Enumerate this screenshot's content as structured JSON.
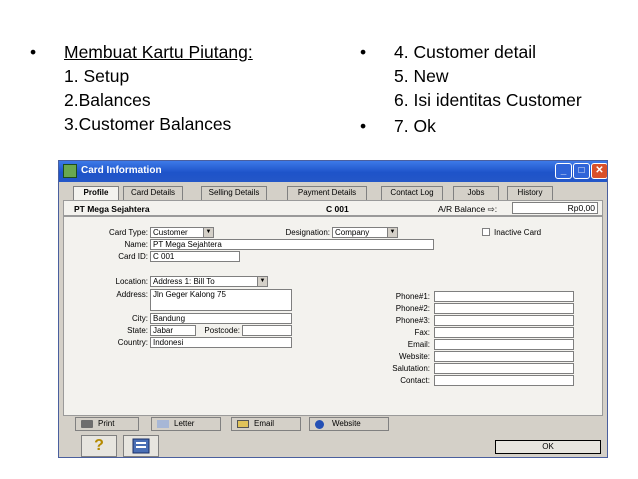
{
  "slide": {
    "left_bullets": [
      "Membuat Kartu Piutang:"
    ],
    "left_sub_lines": [
      "1. Setup",
      "2.Balances",
      "3.Customer Balances"
    ],
    "right_bullets": [
      {
        "lines": [
          "4. Customer detail",
          "5. New",
          "6. Isi identitas Customer"
        ]
      },
      {
        "lines": [
          "7. Ok"
        ]
      }
    ],
    "bullet_glyph": "•"
  },
  "window": {
    "title": "Card Information",
    "controls": {
      "minimize": "_",
      "maximize": "□",
      "close": "✕"
    },
    "tabs": [
      "Profile",
      "Card Details",
      "Selling Details",
      "Payment Details",
      "Contact Log",
      "Jobs",
      "History"
    ],
    "header": {
      "card_name": "PT Mega Sejahtera",
      "card_id": "C 001",
      "ar_label": "A/R Balance ⇨:",
      "ar_value": "Rp0,00"
    },
    "form": {
      "card_type_label": "Card Type:",
      "card_type_value": "Customer",
      "designation_label": "Designation:",
      "designation_value": "Company",
      "inactive_label": "Inactive Card",
      "name_label": "Name:",
      "name_value": "PT Mega Sejahtera",
      "card_id_label": "Card ID:",
      "card_id_value": "C 001",
      "location_label": "Location:",
      "location_value": "Address 1:  Bill To",
      "address_label": "Address:",
      "address_value": "Jln Geger Kalong 75",
      "city_label": "City:",
      "city_value": "Bandung",
      "state_label": "State:",
      "state_value": "Jabar",
      "postcode_label": "Postcode:",
      "postcode_value": "",
      "country_label": "Country:",
      "country_value": "Indonesi",
      "right_fields": [
        {
          "label": "Phone#1:",
          "value": ""
        },
        {
          "label": "Phone#2:",
          "value": ""
        },
        {
          "label": "Phone#3:",
          "value": ""
        },
        {
          "label": "Fax:",
          "value": ""
        },
        {
          "label": "Email:",
          "value": ""
        },
        {
          "label": "Website:",
          "value": ""
        },
        {
          "label": "Salutation:",
          "value": ""
        },
        {
          "label": "Contact:",
          "value": ""
        }
      ]
    },
    "buttons": {
      "print": "Print",
      "letter": "Letter",
      "email": "Email",
      "website": "Website",
      "help": "?",
      "ok": "OK"
    }
  },
  "colors": {
    "titlebar": "#1e53c9",
    "window_bg": "#d4d0c8",
    "panel_bg": "#f3f2ee",
    "close_button": "#d9502a"
  },
  "icons": [
    "card-window-icon",
    "printer-icon",
    "letter-icon",
    "email-icon",
    "globe-icon",
    "help-icon",
    "database-icon"
  ]
}
